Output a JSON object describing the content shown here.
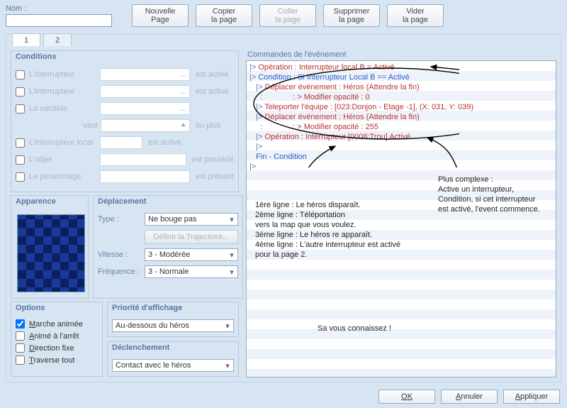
{
  "top": {
    "name_label": "Nom :",
    "name_value": "",
    "buttons": {
      "new": "Nouvelle\nPage",
      "copy": "Copier\nla page",
      "paste": "Coller\nla page",
      "delete": "Supprimer\nla page",
      "clear": "Vider\nla page"
    }
  },
  "tabs": {
    "t1": "1",
    "t2": "2"
  },
  "conditions": {
    "title": "Conditions",
    "switch1": "L'interrupteur",
    "switch2": "L'interrupteur",
    "variable": "La variable",
    "vaut": "vaut",
    "ouplus": "ou plus",
    "local": "L'interrupteur local",
    "item": "L'objet",
    "actor": "Le personnage",
    "after_switch": "est activé",
    "after_item": "est possédé",
    "after_actor": "est présent",
    "ellipsis": "..."
  },
  "appearance": {
    "title": "Apparence"
  },
  "movement": {
    "title": "Déplacement",
    "type_label": "Type :",
    "type_value": "Ne bouge pas",
    "def_route": "Définir la Trajectoire...",
    "speed_label": "Vitesse :",
    "speed_value": "3 - Modérée",
    "freq_label": "Fréquence :",
    "freq_value": "3 - Normale"
  },
  "options": {
    "title": "Options",
    "walk": "Marche animée",
    "stop": "Animé à l'arrêt",
    "dirfix": "Direction fixe",
    "through": "Traverse tout"
  },
  "priority": {
    "title": "Priorité d'affichage",
    "value": "Au-dessous du héros"
  },
  "trigger": {
    "title": "Déclenchement",
    "value": "Contact avec le héros"
  },
  "commands": {
    "title": "Commandes de l'événement",
    "lines": [
      {
        "prefix": "|> ",
        "text": "Opération : Interrupteur local B = Activé",
        "cls": "op-red"
      },
      {
        "prefix": "|> ",
        "text": "Condition : Si Interrupteur Local B == Activé",
        "cls": "op-blue"
      },
      {
        "prefix": "   |> ",
        "text": "Déplacer événement : Héros (Attendre la fin)",
        "cls": "op-red"
      },
      {
        "prefix": "     :              ",
        "text": ": > Modifier opacité : 0",
        "cls": "op-red"
      },
      {
        "prefix": "   |> ",
        "text": "Teleporter l'équipe : [023:Donjon - Etage -1], (X: 031, Y: 039)",
        "cls": "op-red"
      },
      {
        "prefix": "   |> ",
        "text": "Déplacer événement : Héros (Attendre la fin)",
        "cls": "op-red"
      },
      {
        "prefix": "     :              ",
        "text": ": > Modifier opacité : 255",
        "cls": "op-red"
      },
      {
        "prefix": "   |> ",
        "text": "Opération : Interrupteur [0008:Trou] Activé",
        "cls": "op-red"
      },
      {
        "prefix": "   |>",
        "text": "",
        "cls": ""
      },
      {
        "prefix": "   ",
        "text": "Fin - Condition",
        "cls": "op-blue"
      },
      {
        "prefix": "|>",
        "text": "",
        "cls": ""
      }
    ]
  },
  "annotations": {
    "left_block": "1ère ligne : Le héros disparaît.\n2ème ligne : Téléportation\nvers la map que vous voulez.\n3ème ligne : Le héros re apparaît.\n4ème ligne : L'autre interrupteur est activé\npour la page 2.",
    "right_block": "Plus complexe :\nActive un interrupteur,\nCondition, si cet interrupteur\nest activé, l'event commence.",
    "bottom": "Sa vous connaissez !"
  },
  "footer": {
    "ok": "OK",
    "cancel": "Annuler",
    "apply": "Appliquer"
  }
}
